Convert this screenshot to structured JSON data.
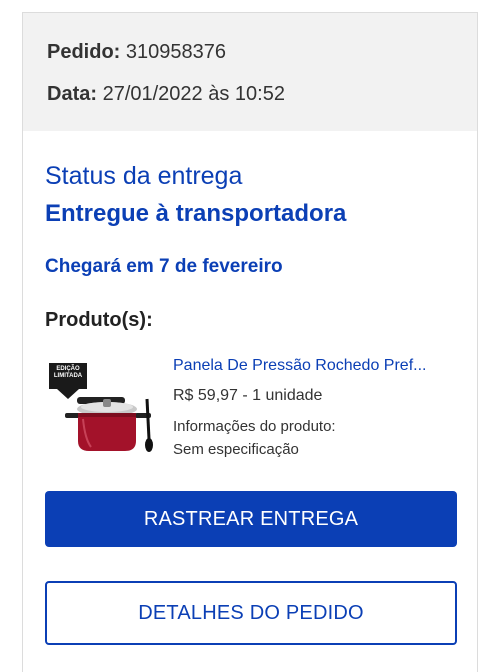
{
  "order": {
    "order_label": "Pedido:",
    "order_number": "310958376",
    "date_label": "Data:",
    "date_value": "27/01/2022 às 10:52"
  },
  "delivery": {
    "status_caption": "Status da entrega",
    "status_value": "Entregue à transportadora",
    "eta": "Chegará em 7 de fevereiro"
  },
  "products": {
    "label": "Produto(s):",
    "items": [
      {
        "badge": "EDIÇÃO LIMITADA",
        "name": "Panela De Pressão Rochedo Pref...",
        "price": "R$ 59,97 - 1 unidade",
        "info_label": "Informações do produto:",
        "info_value": "Sem especificação"
      }
    ]
  },
  "actions": {
    "track_label": "RASTREAR ENTREGA",
    "details_label": "DETALHES DO PEDIDO"
  },
  "colors": {
    "accent": "#0b3fb5",
    "header_bg": "#f2f2f2",
    "pot_red": "#a3122a"
  }
}
